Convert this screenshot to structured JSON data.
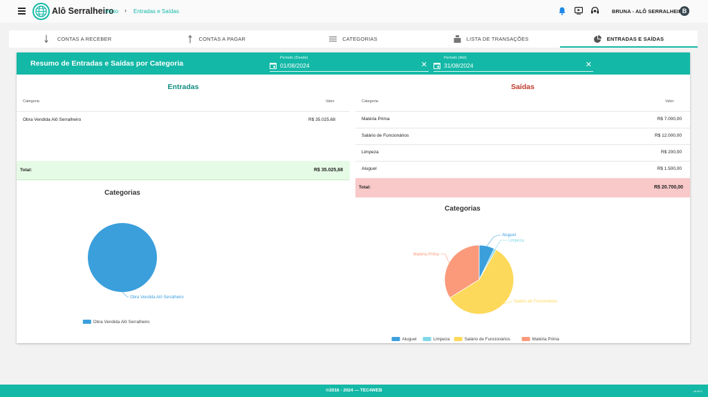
{
  "header": {
    "app_title": "Alô Serralheiro",
    "breadcrumb_home": "Início",
    "breadcrumb_separator": "›",
    "breadcrumb_current": "Entradas e Saídas",
    "user_name": "BRUNA - ALÔ SERRALHEIRO",
    "avatar_letter": "B",
    "icons": [
      "menu-icon",
      "globe-logo",
      "bell-icon",
      "video-icon",
      "support-icon"
    ]
  },
  "tabs": [
    {
      "label": "CONTAS A RECEBER",
      "icon": "arrow-down-icon",
      "active": false
    },
    {
      "label": "CONTAS A PAGAR",
      "icon": "arrow-up-icon",
      "active": false
    },
    {
      "label": "CATEGORIAS",
      "icon": "list-icon",
      "active": false
    },
    {
      "label": "LISTA DE TRANSAÇÕES",
      "icon": "transactions-icon",
      "active": false
    },
    {
      "label": "ENTRADAS E SAÍDAS",
      "icon": "pie-chart-icon",
      "active": true
    }
  ],
  "summary": {
    "title": "Resumo de Entradas e Saídas por Categoria",
    "period_from_label": "Período (Desde)",
    "period_from_value": "01/08/2024",
    "period_to_label": "Período (Até)",
    "period_to_value": "31/08/2024"
  },
  "entradas": {
    "title": "Entradas",
    "col_category": "Categoria",
    "col_value": "Valor",
    "rows": [
      {
        "category": "Obra Vendida Alô Serralheiro",
        "value": "R$ 35.025,68"
      }
    ],
    "total_label": "Total:",
    "total_value": "R$ 35.025,68",
    "chart_title": "Categorias"
  },
  "saidas": {
    "title": "Saídas",
    "col_category": "Categoria",
    "col_value": "Valor",
    "rows": [
      {
        "category": "Matéria Prima",
        "value": "R$ 7.000,00"
      },
      {
        "category": "Salário de Funcionários",
        "value": "R$ 12.000,00"
      },
      {
        "category": "Limpeza",
        "value": "R$ 200,00"
      },
      {
        "category": "Aluguel",
        "value": "R$ 1.500,00"
      }
    ],
    "total_label": "Total:",
    "total_value": "R$ 20.700,00",
    "chart_title": "Categorias"
  },
  "colors": {
    "accent": "#14b8a6",
    "entradas_title": "#0f8c80",
    "saidas_title": "#c0392b",
    "entradas_total_bg": "#e6fbe6",
    "saidas_total_bg": "#f9c9c9"
  },
  "chart_data": [
    {
      "type": "pie",
      "title": "Categorias",
      "categories": [
        "Obra Vendida Alô Serralheiro"
      ],
      "values": [
        35025.68
      ],
      "colors": [
        "#3b9fdc"
      ],
      "legend": "bottom"
    },
    {
      "type": "pie",
      "title": "Categorias",
      "categories": [
        "Aluguel",
        "Limpeza",
        "Salário de Funcionários",
        "Matéria Prima"
      ],
      "values": [
        1500,
        200,
        12000,
        7000
      ],
      "colors": [
        "#3b9fdc",
        "#7fd8e6",
        "#fcd95a",
        "#fb9a7b"
      ],
      "legend": "bottom"
    }
  ],
  "footer": {
    "text": "©2016 - 2024 — TEC4WEB",
    "version": "v4.49.1"
  }
}
